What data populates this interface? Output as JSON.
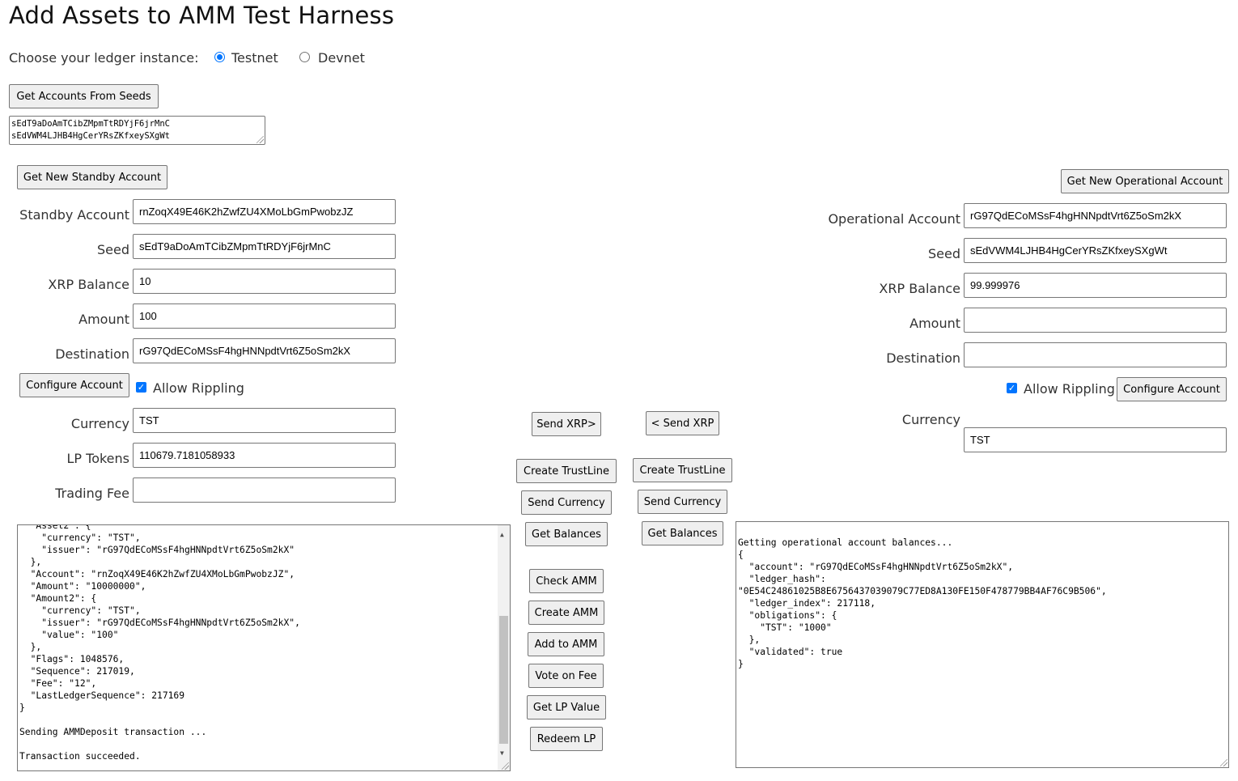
{
  "page": {
    "title": "Add Assets to AMM Test Harness",
    "ledger_prompt": "Choose your ledger instance:",
    "ledger_options": [
      {
        "label": "Testnet",
        "selected": true
      },
      {
        "label": "Devnet",
        "selected": false
      }
    ],
    "get_accounts_button": "Get Accounts From Seeds",
    "seeds": [
      "sEdT9aDoAmTCibZMpmTtRDYjF6jrMnC",
      "sEdVWM4LJHB4HgCerYRsZKfxeySXgWt"
    ]
  },
  "standby": {
    "new_account_button": "Get New Standby Account",
    "account_label": "Standby Account",
    "account_value": "rnZoqX49E46K2hZwfZU4XMoLbGmPwobzJZ",
    "seed_label": "Seed",
    "seed_value": "sEdT9aDoAmTCibZMpmTtRDYjF6jrMnC",
    "xrp_balance_label": "XRP Balance",
    "xrp_balance_value": "10",
    "amount_label": "Amount",
    "amount_value": "100",
    "destination_label": "Destination",
    "destination_value": "rG97QdECoMSsF4hgHNNpdtVrt6Z5oSm2kX",
    "configure_button": "Configure Account",
    "allow_rippling_label": "Allow Rippling",
    "allow_rippling_checked": true,
    "currency_label": "Currency",
    "currency_value": "TST",
    "lp_tokens_label": "LP Tokens",
    "lp_tokens_value": "110679.7181058933",
    "trading_fee_label": "Trading Fee",
    "trading_fee_value": "",
    "log": "  \"Asset2\": {\n    \"currency\": \"TST\",\n    \"issuer\": \"rG97QdECoMSsF4hgHNNpdtVrt6Z5oSm2kX\"\n  },\n  \"Account\": \"rnZoqX49E46K2hZwfZU4XMoLbGmPwobzJZ\",\n  \"Amount\": \"10000000\",\n  \"Amount2\": {\n    \"currency\": \"TST\",\n    \"issuer\": \"rG97QdECoMSsF4hgHNNpdtVrt6Z5oSm2kX\",\n    \"value\": \"100\"\n  },\n  \"Flags\": 1048576,\n  \"Sequence\": 217019,\n  \"Fee\": \"12\",\n  \"LastLedgerSequence\": 217169\n}\n\nSending AMMDeposit transaction ...\n\nTransaction succeeded."
  },
  "actions": {
    "send_xrp_right": "Send XRP>",
    "send_xrp_left": "< Send XRP",
    "create_trustline": "Create TrustLine",
    "send_currency": "Send Currency",
    "get_balances": "Get Balances",
    "amm_buttons": [
      "Check AMM",
      "Create AMM",
      "Add to AMM",
      "Vote on Fee",
      "Get LP Value",
      "Redeem LP"
    ]
  },
  "operational": {
    "new_account_button": "Get New Operational Account",
    "account_label": "Operational Account",
    "account_value": "rG97QdECoMSsF4hgHNNpdtVrt6Z5oSm2kX",
    "seed_label": "Seed",
    "seed_value": "sEdVWM4LJHB4HgCerYRsZKfxeySXgWt",
    "xrp_balance_label": "XRP Balance",
    "xrp_balance_value": "99.999976",
    "amount_label": "Amount",
    "amount_value": "",
    "destination_label": "Destination",
    "destination_value": "",
    "allow_rippling_label": "Allow Rippling",
    "allow_rippling_checked": true,
    "configure_button": "Configure Account",
    "currency_label": "Currency",
    "currency_value": "TST",
    "log": "\nGetting operational account balances...\n{\n  \"account\": \"rG97QdECoMSsF4hgHNNpdtVrt6Z5oSm2kX\",\n  \"ledger_hash\":\n\"0E54C24861025B8E6756437039079C77ED8A130FE150F478779BB4AF76C9B506\",\n  \"ledger_index\": 217118,\n  \"obligations\": {\n    \"TST\": \"1000\"\n  },\n  \"validated\": true\n}"
  },
  "colors": {
    "accent": "#0075ff",
    "button_bg": "#efefef",
    "border": "#767676"
  }
}
